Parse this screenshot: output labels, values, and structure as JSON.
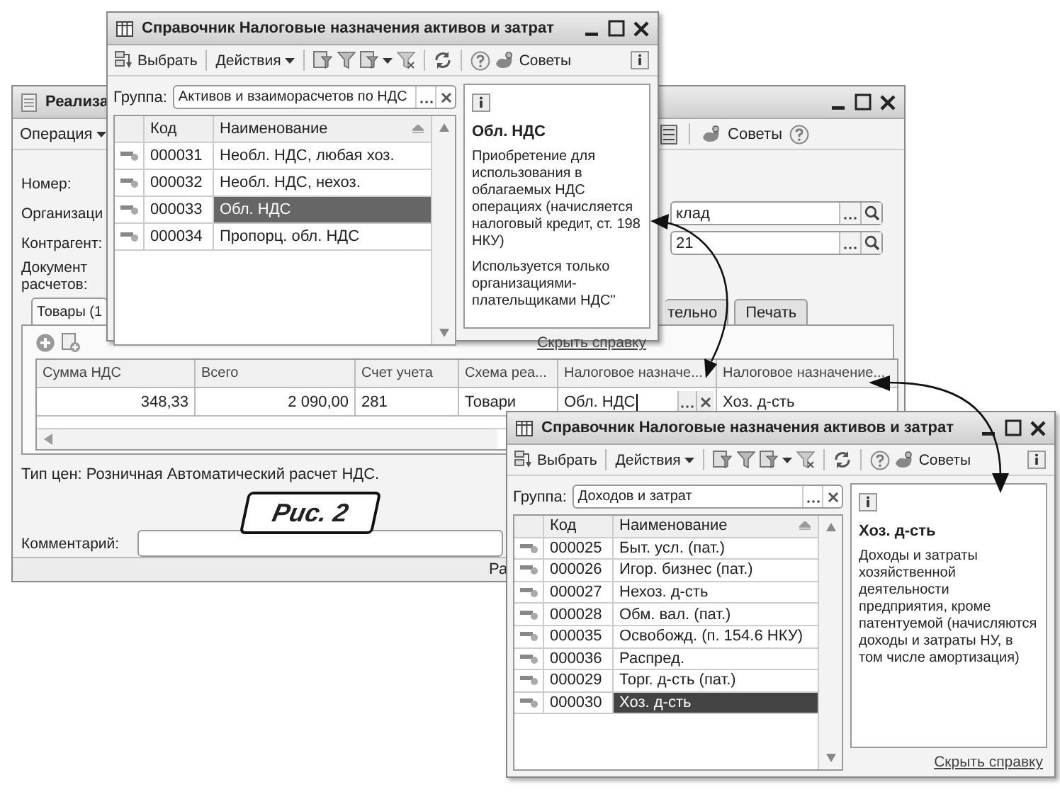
{
  "main_window": {
    "title": "Реализа",
    "menu": "Операция",
    "tips": "Советы",
    "fields": [
      {
        "label": "Номер:"
      },
      {
        "label": "Организаци",
        "value": "клад"
      },
      {
        "label": "Контрагент:",
        "value": "21"
      },
      {
        "label": "Документ расчетов:"
      }
    ],
    "tabs": [
      {
        "label": "Товары (1",
        "selected": true
      },
      {
        "label": "тельно",
        "selected": false
      },
      {
        "label": "Печать",
        "selected": false
      }
    ],
    "table": {
      "columns": [
        "Сумма НДС",
        "Всего",
        "Счет учета",
        "Схема реа...",
        "Налоговое назначе...",
        "Налоговое назначение..."
      ],
      "rows": [
        {
          "cells": [
            {
              "text": "348,33"
            },
            {
              "text": "2 090,00"
            },
            {
              "text": "281"
            },
            {
              "text": "Товари"
            },
            {
              "text": "Обл. НДС",
              "editing": true
            },
            {
              "text": "Хоз. д-сть",
              "editing": false
            }
          ]
        }
      ]
    },
    "price_type": "Тип цен: Розничная Автоматический расчет НДС.",
    "comment_label": "Комментарий:",
    "status": "Ра"
  },
  "figure_caption": "Рис. 2",
  "directories": [
    {
      "title": "Справочник Налоговые назначения активов и затрат",
      "select": "Выбрать",
      "actions": "Действия",
      "tips": "Советы",
      "group_label": "Группа:",
      "group_value": "Активов и взаиморасчетов по НДС",
      "columns": [
        "Код",
        "Наименование"
      ],
      "rows": [
        {
          "code": "000031",
          "name": "Необл. НДС, любая хоз.",
          "selected": false
        },
        {
          "code": "000032",
          "name": "Необл. НДС, нехоз.",
          "selected": false
        },
        {
          "code": "000033",
          "name": "Обл. НДС",
          "selected": true
        },
        {
          "code": "000034",
          "name": "Пропорц. обл. НДС",
          "selected": false
        }
      ],
      "help": {
        "title": "Обл. НДС",
        "paragraphs": [
          "Приобретение для использования в облагаемых НДС операциях (начисляется налоговый кредит, ст. 198 НКУ)",
          "Используется только организациями-плательщиками НДС\""
        ]
      },
      "hide_help": "Скрыть справку"
    },
    {
      "title": "Справочник Налоговые назначения активов и затрат",
      "select": "Выбрать",
      "actions": "Действия",
      "tips": "Советы",
      "group_label": "Группа:",
      "group_value": "Доходов и затрат",
      "columns": [
        "Код",
        "Наименование"
      ],
      "rows": [
        {
          "code": "000025",
          "name": "Быт. усл. (пат.)",
          "selected": false
        },
        {
          "code": "000026",
          "name": "Игор. бизнес (пат.)",
          "selected": false
        },
        {
          "code": "000027",
          "name": "Нехоз. д-сть",
          "selected": false
        },
        {
          "code": "000028",
          "name": "Обм. вал. (пат.)",
          "selected": false
        },
        {
          "code": "000035",
          "name": "Освобожд. (п. 154.6 НКУ)",
          "selected": false
        },
        {
          "code": "000036",
          "name": "Распред.",
          "selected": false
        },
        {
          "code": "000029",
          "name": "Торг. д-сть (пат.)",
          "selected": false
        },
        {
          "code": "000030",
          "name": "Хоз. д-сть",
          "selected": true
        }
      ],
      "help": {
        "title": "Хоз. д-сть",
        "paragraphs": [
          "Доходы и затраты хозяйственной деятельности предприятия, кроме патентуемой (начисляются доходы и затраты НУ, в том числе амортизация)"
        ]
      },
      "hide_help": "Скрыть справку"
    }
  ]
}
